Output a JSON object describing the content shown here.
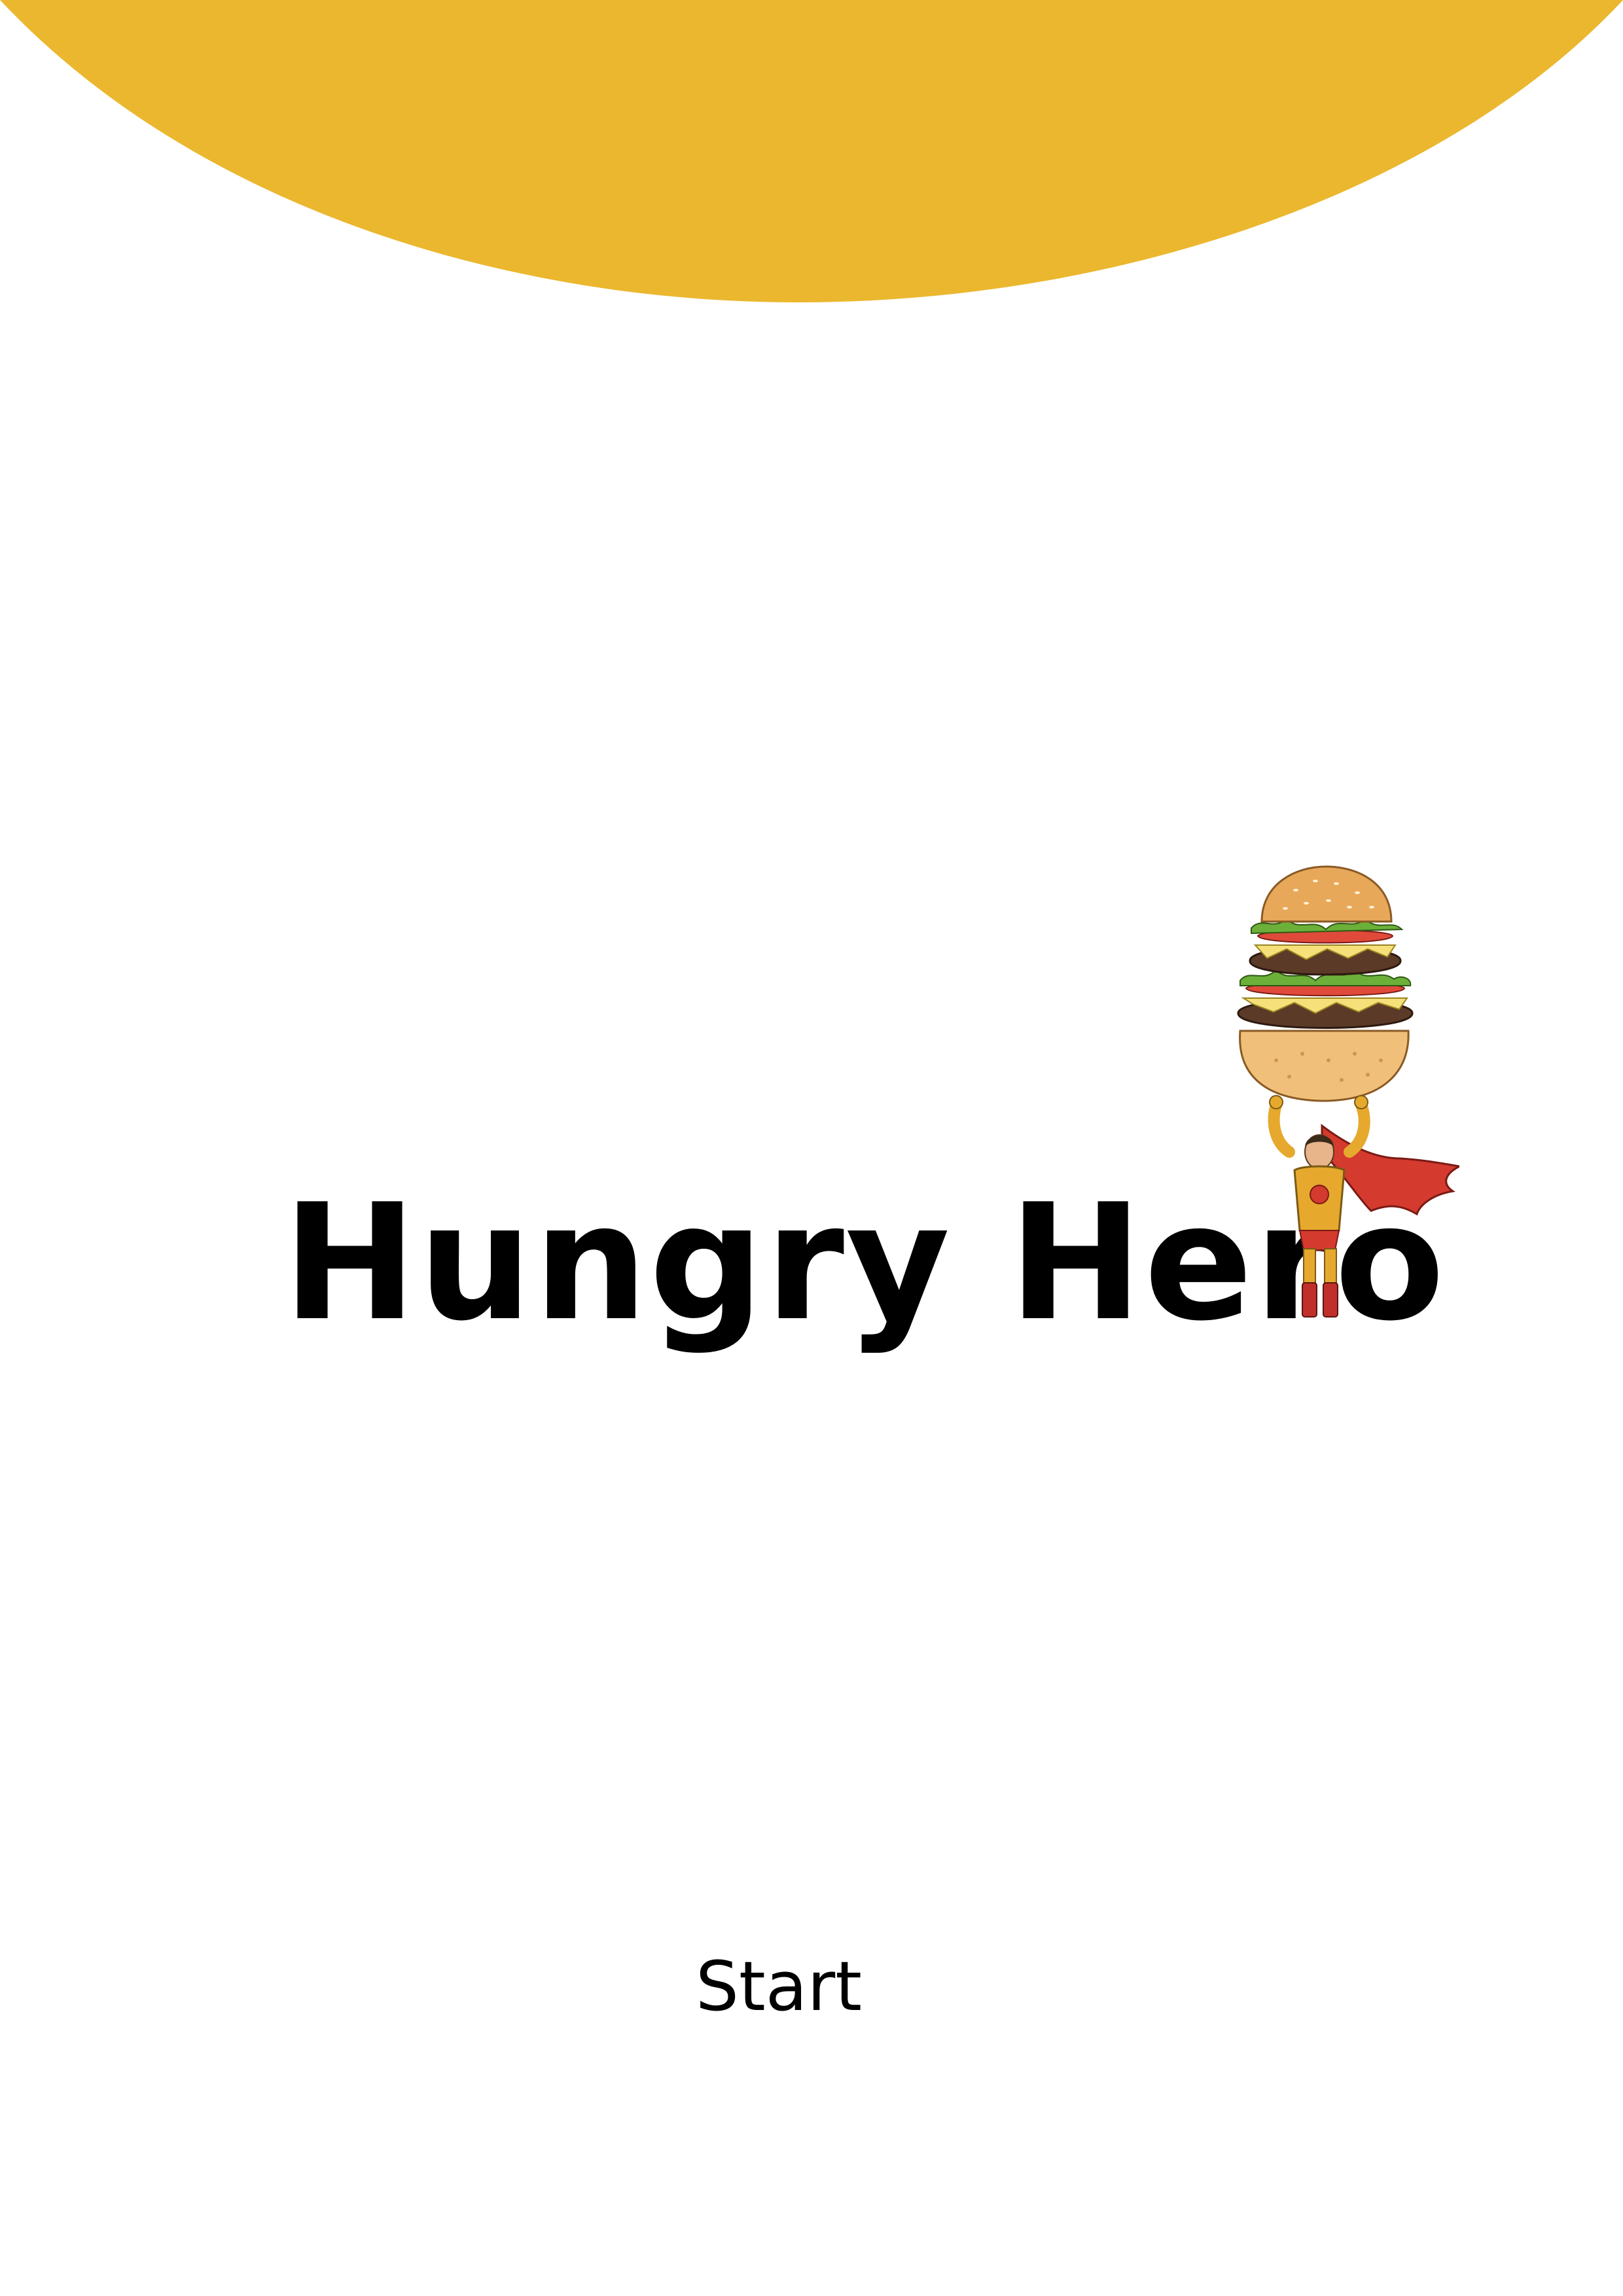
{
  "app": {
    "title": "Hungry Hero",
    "accent_color": "#EBB72E"
  },
  "menu": {
    "start_label": "Start"
  },
  "logo": {
    "icon": "burger-hero-icon"
  }
}
